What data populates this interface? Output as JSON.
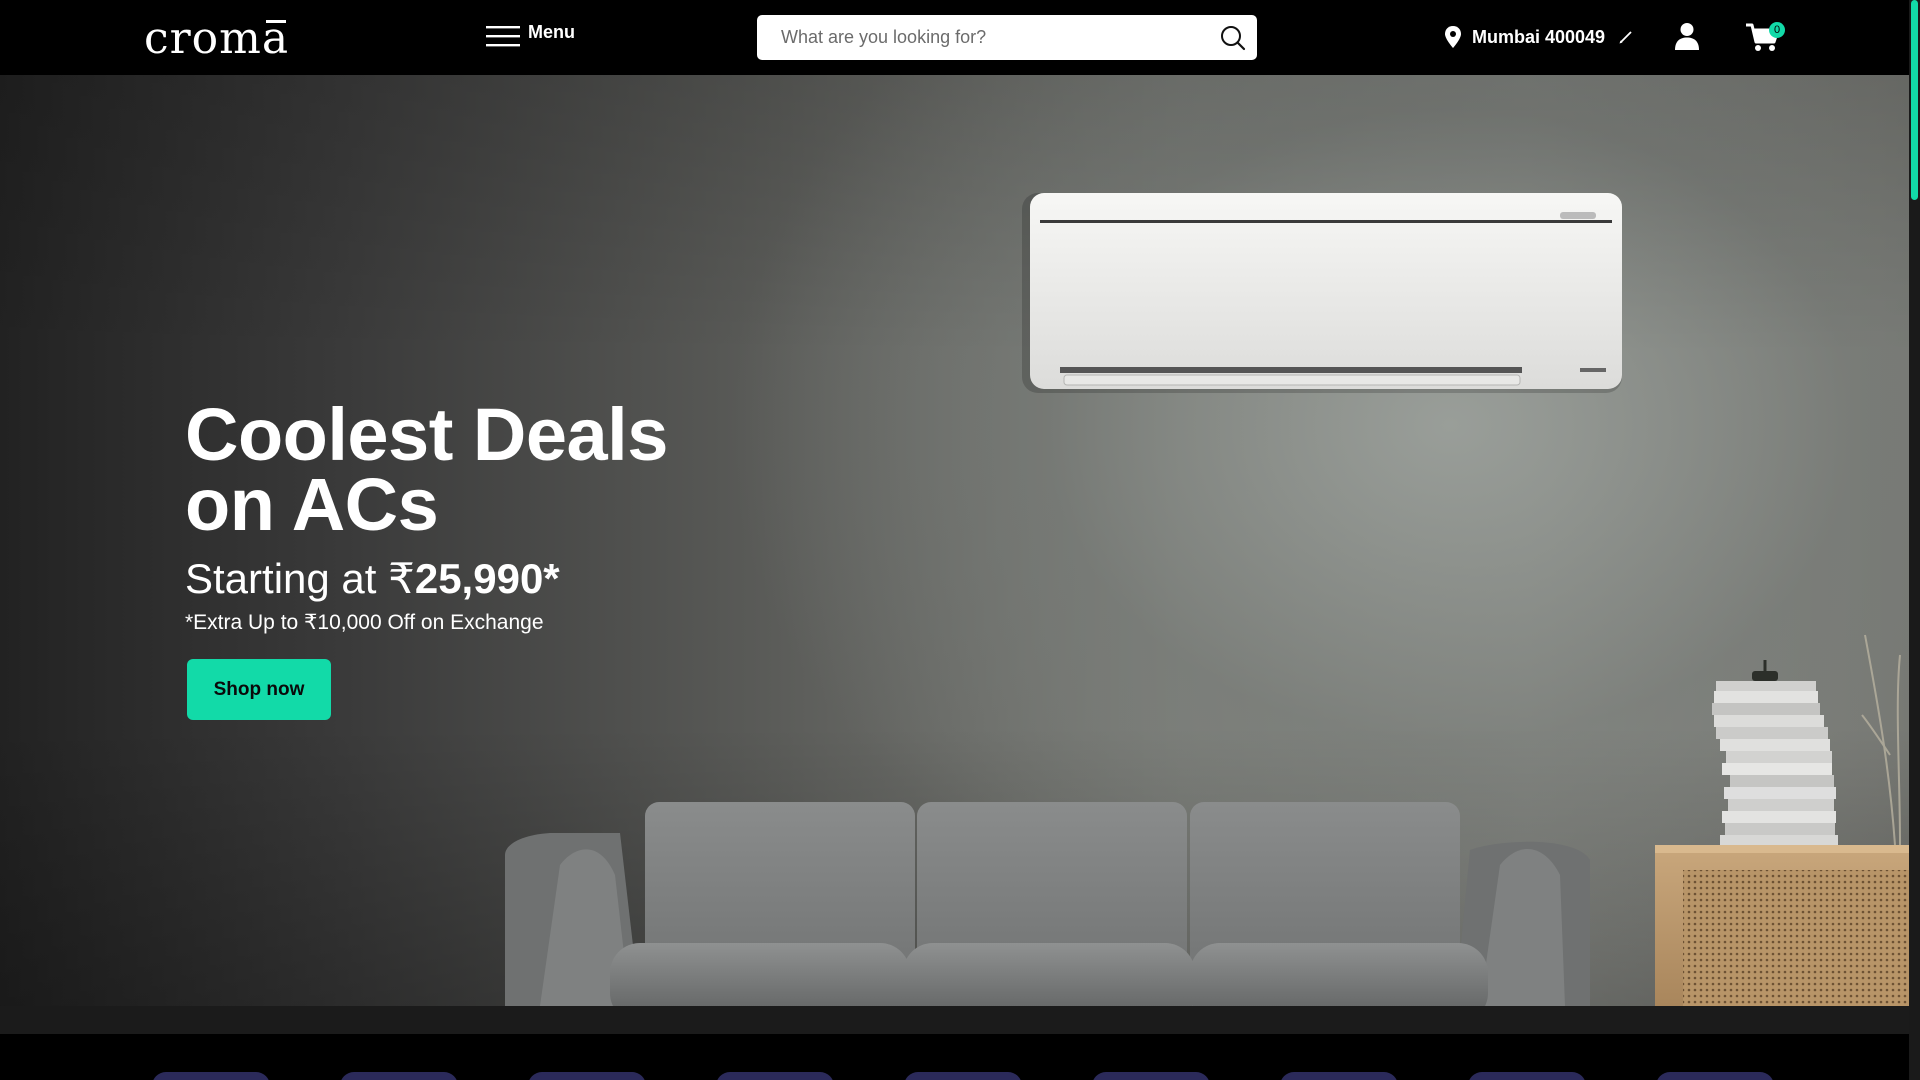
{
  "header": {
    "logo_text": "croma",
    "menu_label": "Menu",
    "search": {
      "placeholder": "What are you looking for?"
    },
    "location": "Mumbai 400049",
    "cart_count": "0"
  },
  "hero": {
    "title": "Coolest Deals\non ACs",
    "subtitle_prefix": "Starting at ",
    "currency_symbol": "₹",
    "price": "25,990*",
    "note": "*Extra Up to ₹10,000 Off on Exchange",
    "cta_label": "Shop now"
  },
  "colors": {
    "accent": "#12daa8",
    "header_bg": "#000000",
    "category_pill": "#2b2a5a"
  },
  "icons": {
    "menu": "hamburger-icon",
    "search": "search-icon",
    "location": "location-pin-icon",
    "edit": "pencil-icon",
    "user": "user-icon",
    "cart": "cart-icon"
  }
}
